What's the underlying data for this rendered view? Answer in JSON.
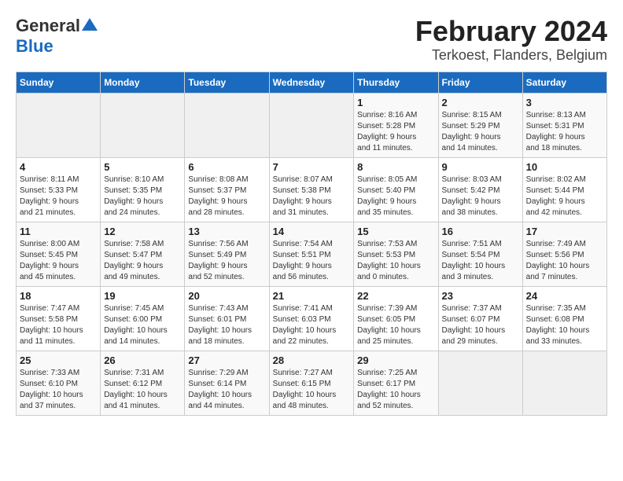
{
  "logo": {
    "line1": "General",
    "line2": "Blue"
  },
  "title": "February 2024",
  "subtitle": "Terkoest, Flanders, Belgium",
  "weekdays": [
    "Sunday",
    "Monday",
    "Tuesday",
    "Wednesday",
    "Thursday",
    "Friday",
    "Saturday"
  ],
  "weeks": [
    [
      {
        "day": "",
        "info": ""
      },
      {
        "day": "",
        "info": ""
      },
      {
        "day": "",
        "info": ""
      },
      {
        "day": "",
        "info": ""
      },
      {
        "day": "1",
        "info": "Sunrise: 8:16 AM\nSunset: 5:28 PM\nDaylight: 9 hours\nand 11 minutes."
      },
      {
        "day": "2",
        "info": "Sunrise: 8:15 AM\nSunset: 5:29 PM\nDaylight: 9 hours\nand 14 minutes."
      },
      {
        "day": "3",
        "info": "Sunrise: 8:13 AM\nSunset: 5:31 PM\nDaylight: 9 hours\nand 18 minutes."
      }
    ],
    [
      {
        "day": "4",
        "info": "Sunrise: 8:11 AM\nSunset: 5:33 PM\nDaylight: 9 hours\nand 21 minutes."
      },
      {
        "day": "5",
        "info": "Sunrise: 8:10 AM\nSunset: 5:35 PM\nDaylight: 9 hours\nand 24 minutes."
      },
      {
        "day": "6",
        "info": "Sunrise: 8:08 AM\nSunset: 5:37 PM\nDaylight: 9 hours\nand 28 minutes."
      },
      {
        "day": "7",
        "info": "Sunrise: 8:07 AM\nSunset: 5:38 PM\nDaylight: 9 hours\nand 31 minutes."
      },
      {
        "day": "8",
        "info": "Sunrise: 8:05 AM\nSunset: 5:40 PM\nDaylight: 9 hours\nand 35 minutes."
      },
      {
        "day": "9",
        "info": "Sunrise: 8:03 AM\nSunset: 5:42 PM\nDaylight: 9 hours\nand 38 minutes."
      },
      {
        "day": "10",
        "info": "Sunrise: 8:02 AM\nSunset: 5:44 PM\nDaylight: 9 hours\nand 42 minutes."
      }
    ],
    [
      {
        "day": "11",
        "info": "Sunrise: 8:00 AM\nSunset: 5:45 PM\nDaylight: 9 hours\nand 45 minutes."
      },
      {
        "day": "12",
        "info": "Sunrise: 7:58 AM\nSunset: 5:47 PM\nDaylight: 9 hours\nand 49 minutes."
      },
      {
        "day": "13",
        "info": "Sunrise: 7:56 AM\nSunset: 5:49 PM\nDaylight: 9 hours\nand 52 minutes."
      },
      {
        "day": "14",
        "info": "Sunrise: 7:54 AM\nSunset: 5:51 PM\nDaylight: 9 hours\nand 56 minutes."
      },
      {
        "day": "15",
        "info": "Sunrise: 7:53 AM\nSunset: 5:53 PM\nDaylight: 10 hours\nand 0 minutes."
      },
      {
        "day": "16",
        "info": "Sunrise: 7:51 AM\nSunset: 5:54 PM\nDaylight: 10 hours\nand 3 minutes."
      },
      {
        "day": "17",
        "info": "Sunrise: 7:49 AM\nSunset: 5:56 PM\nDaylight: 10 hours\nand 7 minutes."
      }
    ],
    [
      {
        "day": "18",
        "info": "Sunrise: 7:47 AM\nSunset: 5:58 PM\nDaylight: 10 hours\nand 11 minutes."
      },
      {
        "day": "19",
        "info": "Sunrise: 7:45 AM\nSunset: 6:00 PM\nDaylight: 10 hours\nand 14 minutes."
      },
      {
        "day": "20",
        "info": "Sunrise: 7:43 AM\nSunset: 6:01 PM\nDaylight: 10 hours\nand 18 minutes."
      },
      {
        "day": "21",
        "info": "Sunrise: 7:41 AM\nSunset: 6:03 PM\nDaylight: 10 hours\nand 22 minutes."
      },
      {
        "day": "22",
        "info": "Sunrise: 7:39 AM\nSunset: 6:05 PM\nDaylight: 10 hours\nand 25 minutes."
      },
      {
        "day": "23",
        "info": "Sunrise: 7:37 AM\nSunset: 6:07 PM\nDaylight: 10 hours\nand 29 minutes."
      },
      {
        "day": "24",
        "info": "Sunrise: 7:35 AM\nSunset: 6:08 PM\nDaylight: 10 hours\nand 33 minutes."
      }
    ],
    [
      {
        "day": "25",
        "info": "Sunrise: 7:33 AM\nSunset: 6:10 PM\nDaylight: 10 hours\nand 37 minutes."
      },
      {
        "day": "26",
        "info": "Sunrise: 7:31 AM\nSunset: 6:12 PM\nDaylight: 10 hours\nand 41 minutes."
      },
      {
        "day": "27",
        "info": "Sunrise: 7:29 AM\nSunset: 6:14 PM\nDaylight: 10 hours\nand 44 minutes."
      },
      {
        "day": "28",
        "info": "Sunrise: 7:27 AM\nSunset: 6:15 PM\nDaylight: 10 hours\nand 48 minutes."
      },
      {
        "day": "29",
        "info": "Sunrise: 7:25 AM\nSunset: 6:17 PM\nDaylight: 10 hours\nand 52 minutes."
      },
      {
        "day": "",
        "info": ""
      },
      {
        "day": "",
        "info": ""
      }
    ]
  ]
}
